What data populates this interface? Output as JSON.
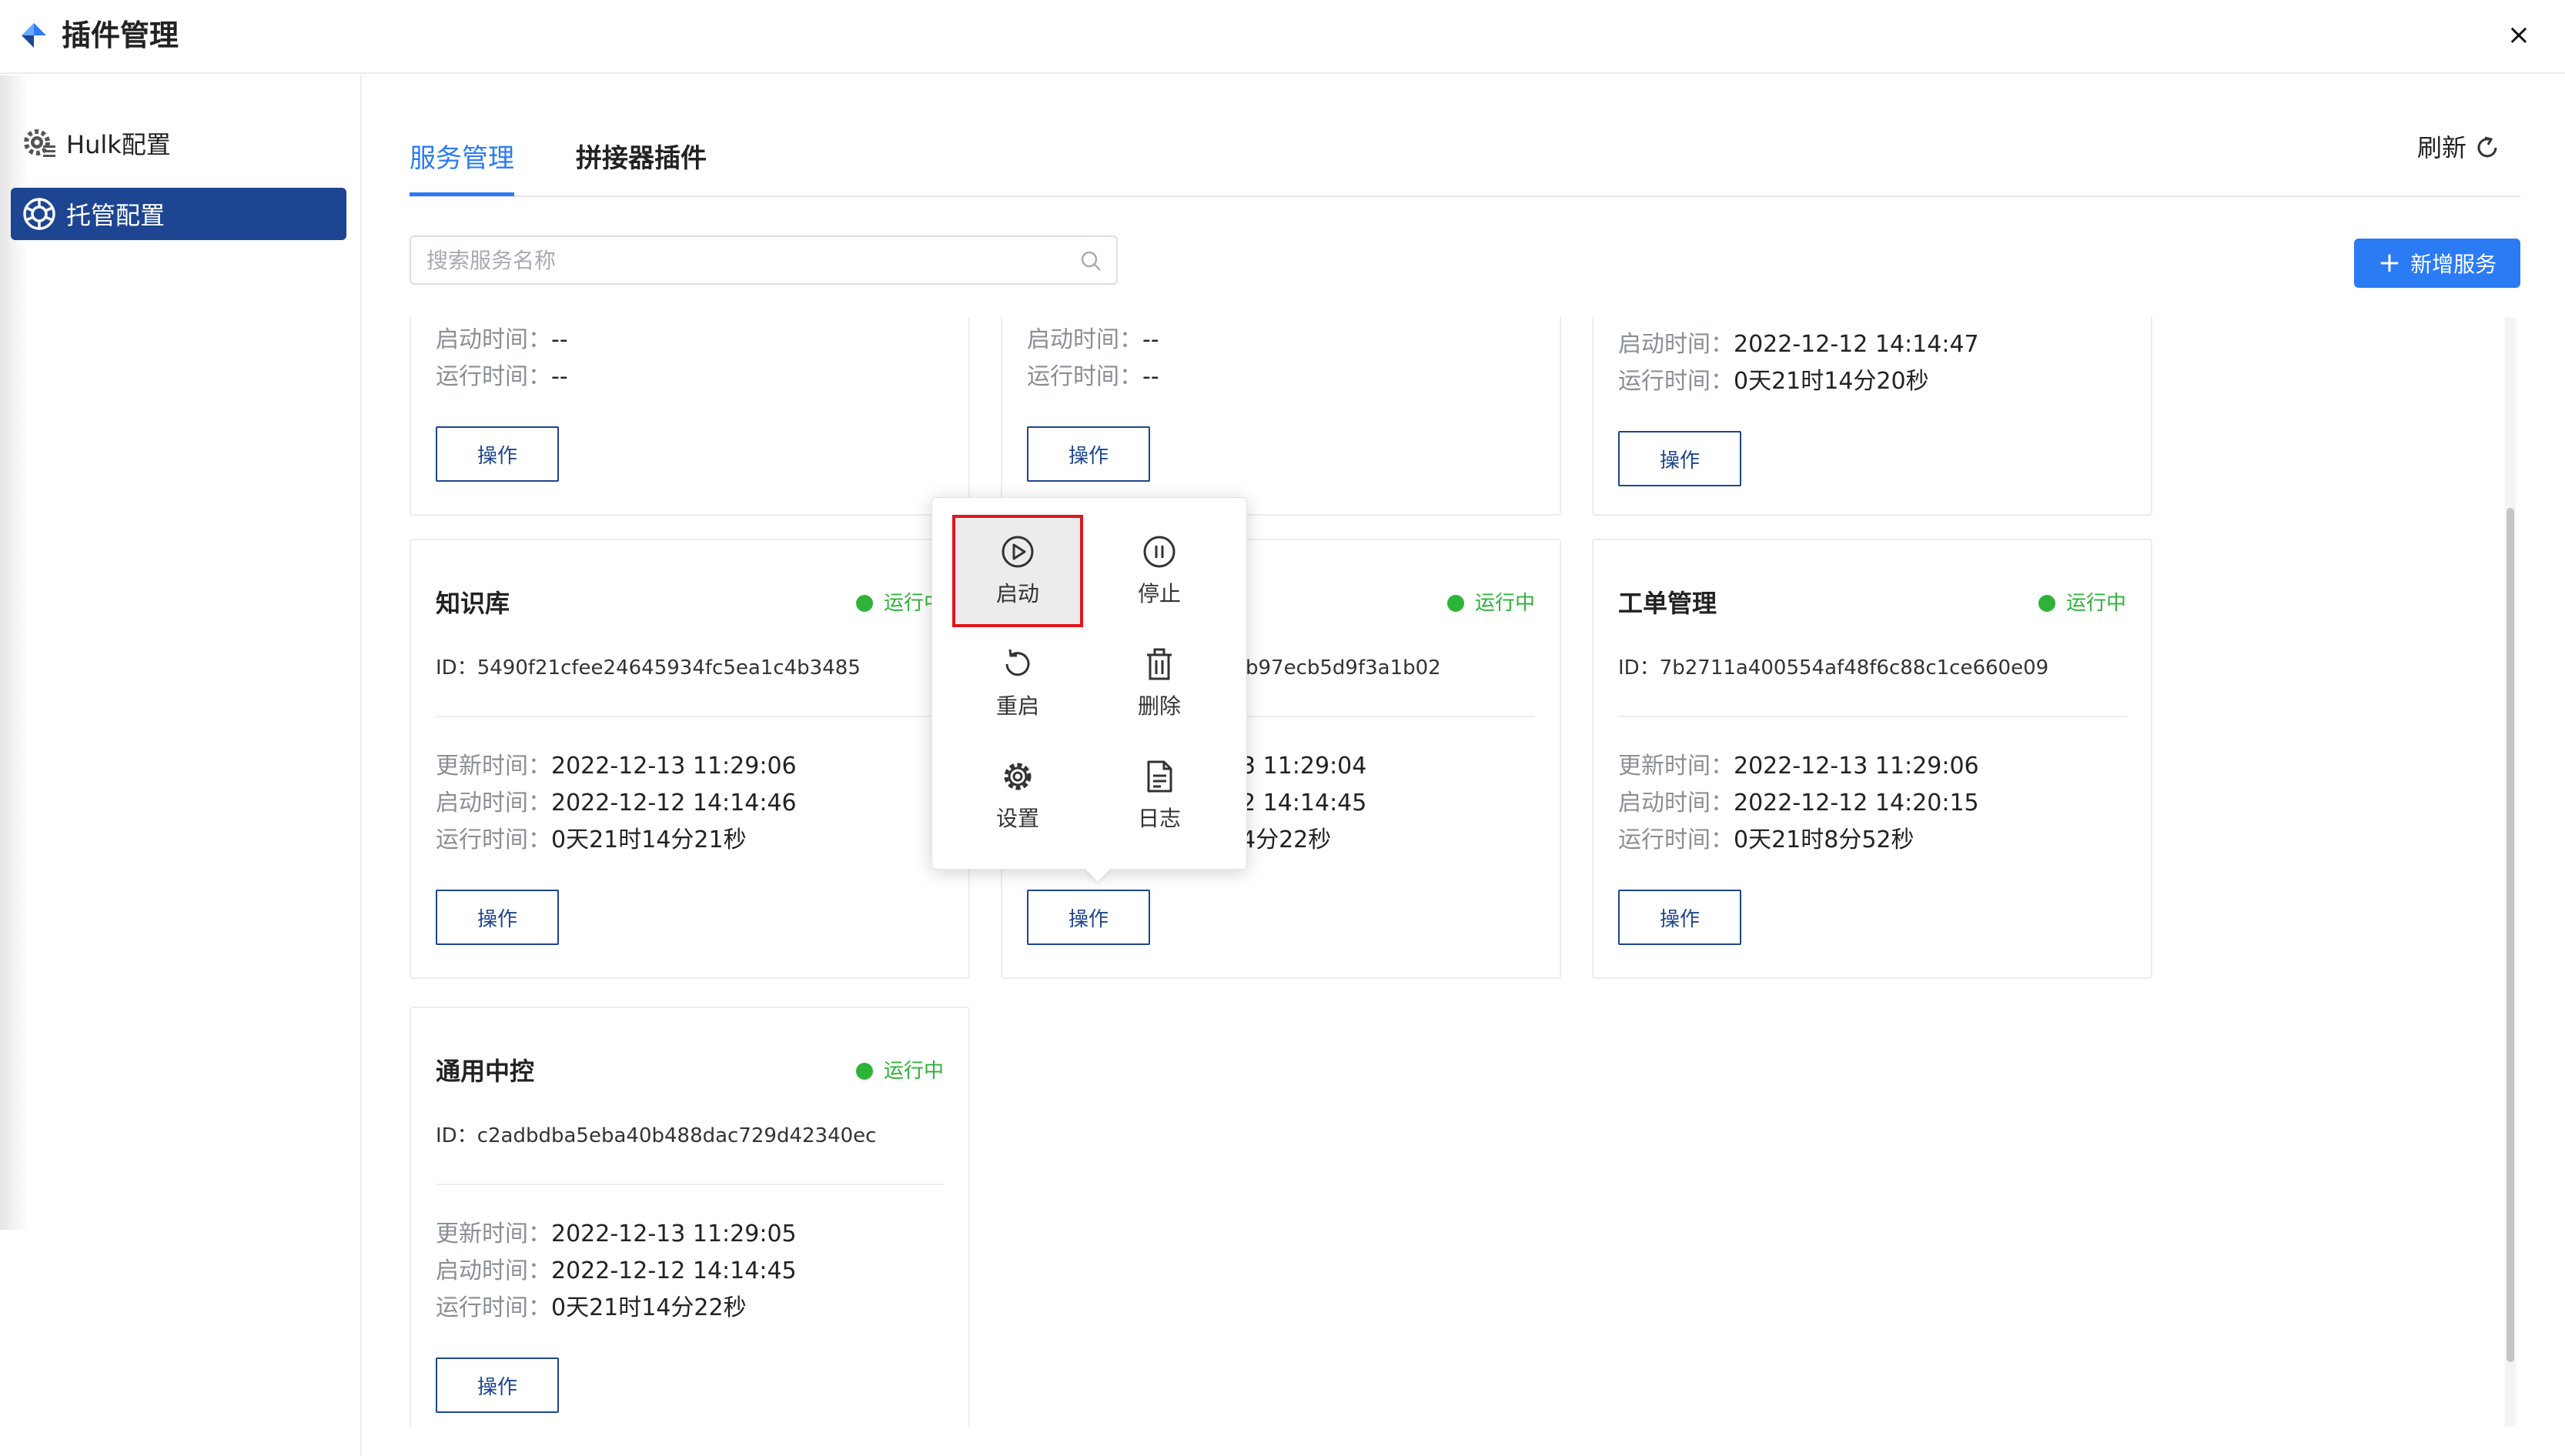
{
  "app": {
    "title": "插件管理",
    "close_label": "×"
  },
  "sidebar": {
    "items": [
      {
        "label": "Hulk配置",
        "icon": "gear-icon",
        "active": false
      },
      {
        "label": "托管配置",
        "icon": "hosting-icon",
        "active": true
      }
    ]
  },
  "tabs": [
    {
      "label": "服务管理",
      "active": true
    },
    {
      "label": "拼接器插件",
      "active": false
    }
  ],
  "refresh_label": "刷新",
  "search": {
    "placeholder": "搜索服务名称",
    "value": ""
  },
  "add_button_label": "新增服务",
  "labels": {
    "update_time": "更新时间：",
    "start_time": "启动时间：",
    "run_time": "运行时间：",
    "id_prefix": "ID："
  },
  "operate_label": "操作",
  "cards": [
    {
      "name": "",
      "status": "",
      "id": "",
      "update_time": "",
      "start_time": "--",
      "run_time": "--"
    },
    {
      "name": "",
      "status": "",
      "id": "",
      "update_time": "",
      "start_time": "--",
      "run_time": "--"
    },
    {
      "name": "",
      "status": "",
      "id": "",
      "update_time": "",
      "start_time": "2022-12-12 14:14:47",
      "run_time": "0天21时14分20秒"
    },
    {
      "name": "知识库",
      "status": "运行中",
      "id": "5490f21cfee24645934fc5ea1c4b3485",
      "update_time": "2022-12-13 11:29:06",
      "start_time": "2022-12-12 14:14:46",
      "run_time": "0天21时14分21秒"
    },
    {
      "name": "",
      "status": "运行中",
      "id": "b97ecb5d9f3a1b02",
      "update_time": "3 11:29:04",
      "start_time": "2 14:14:45",
      "run_time": "4分22秒"
    },
    {
      "name": "工单管理",
      "status": "运行中",
      "id": "7b2711a400554af48f6c88c1ce660e09",
      "update_time": "2022-12-13 11:29:06",
      "start_time": "2022-12-12 14:20:15",
      "run_time": "0天21时8分52秒"
    },
    {
      "name": "通用中控",
      "status": "运行中",
      "id": "c2adbdba5eba40b488dac729d42340ec",
      "update_time": "2022-12-13 11:29:05",
      "start_time": "2022-12-12 14:14:45",
      "run_time": "0天21时14分22秒"
    }
  ],
  "popup_menu": {
    "items": [
      {
        "label": "启动",
        "icon": "play-circle-icon",
        "highlighted": true
      },
      {
        "label": "停止",
        "icon": "pause-circle-icon",
        "highlighted": false
      },
      {
        "label": "重启",
        "icon": "restart-icon",
        "highlighted": false
      },
      {
        "label": "删除",
        "icon": "trash-icon",
        "highlighted": false
      },
      {
        "label": "设置",
        "icon": "settings-icon",
        "highlighted": false
      },
      {
        "label": "日志",
        "icon": "log-file-icon",
        "highlighted": false
      }
    ]
  },
  "colors": {
    "accent": "#2a7bf4",
    "sidebar_active": "#1d4591",
    "running": "#2eb33a",
    "highlight_border": "#e0161b"
  }
}
